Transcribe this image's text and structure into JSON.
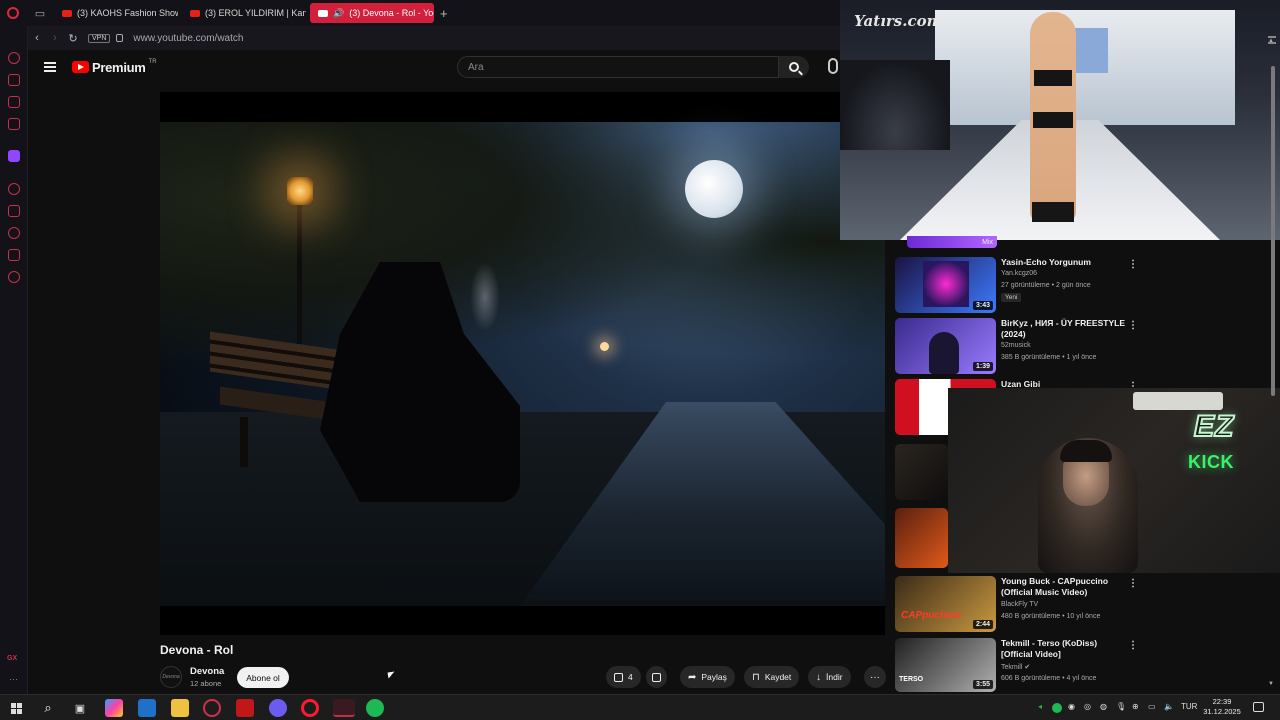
{
  "browser": {
    "tabs": [
      {
        "label": "(3) KAOHS Fashion Show 2",
        "active": false
      },
      {
        "label": "(3) EROL YILDIRIM | Kanal",
        "active": false
      },
      {
        "label": "(3) Devona - Rol - You",
        "active": true
      }
    ],
    "vpn_label": "VPN",
    "url": "www.youtube.com/watch",
    "gx_label": "GX"
  },
  "youtube": {
    "logo_word": "Premium",
    "logo_region": "TR",
    "search_placeholder": "Ara"
  },
  "video": {
    "title": "Devona - Rol",
    "channel": "Devona",
    "channel_avatar_text": "Devona",
    "subscribers": "12 abone",
    "subscribe_label": "Abone ol",
    "likes": "4",
    "share_label": "Paylaş",
    "save_label": "Kaydet",
    "download_label": "İndir"
  },
  "stream_overlay": {
    "watermark": "Yatırs.com",
    "kick_top": "EZ",
    "kick_bottom": "KICK"
  },
  "recommendations": {
    "mix_label": "Mix",
    "items": [
      {
        "title": "Yasin-Echo Yorgunum",
        "channel": "Yan.kcgz06",
        "meta": "27 görüntüleme • 2 gün önce",
        "badge": "Yeni",
        "duration": "3:43",
        "colors": [
          "#1b1242",
          "#3c7bff"
        ]
      },
      {
        "title": "BirKyz , НИЯ - ÜY FREESTYLE (2024)",
        "channel": "52musick",
        "meta": "385 B görüntüleme • 1 yıl önce",
        "duration": "1:39",
        "colors": [
          "#3a2a8e",
          "#9a7bff"
        ]
      },
      {
        "title": "Uzan Gibi",
        "colors": [
          "#d01020",
          "#ffffff"
        ]
      },
      {
        "title": "Young Buck - CAPpuccino (Official Music Video)",
        "channel": "BlackFly TV",
        "meta": "480 B görüntüleme • 10 yıl önce",
        "duration": "2:44",
        "thumb_text": "CAPpuchino",
        "colors": [
          "#3b2a18",
          "#c99a40"
        ]
      },
      {
        "title": "Tekmill - Terso (KoDiss) [Official Video]",
        "channel": "Tekmill",
        "meta": "606 B görüntüleme • 4 yıl önce",
        "duration": "3:55",
        "thumb_text": "TERSO",
        "colors": [
          "#202020",
          "#b0b0b0"
        ]
      }
    ]
  },
  "taskbar": {
    "language": "TUR",
    "time": "22:39",
    "date": "31.12.2025"
  }
}
